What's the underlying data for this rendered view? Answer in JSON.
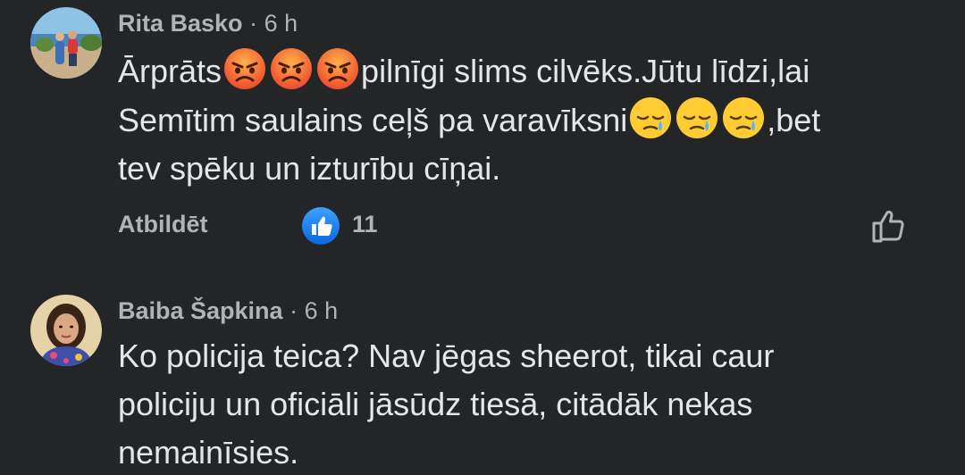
{
  "comments": [
    {
      "author": "Rita Basko",
      "separator": "·",
      "time": "6 h",
      "text": {
        "line1_pre": "Ārprāts",
        "line1_post": "pilnīgi slims cilvēks.Jūtu līdzi,lai",
        "line2_pre": "Semītim saulains ceļš pa varavīksni",
        "line2_post": ",bet",
        "line3": "tev spēku un izturību cīņai."
      },
      "emojis": [
        "angry-face-icon",
        "angry-face-icon",
        "angry-face-icon",
        "sad-tear-face-icon",
        "sad-tear-face-icon",
        "sad-tear-face-icon"
      ],
      "reply_label": "Atbildēt",
      "reaction_count": "11",
      "reaction_type": "like"
    },
    {
      "author": "Baiba Šapkina",
      "separator": "·",
      "time": "6 h",
      "text": {
        "line1": "Ko policija teica? Nav jēgas sheerot, tikai caur",
        "line2": "policiju un oficiāli jāsūdz tiesā, citādāk nekas",
        "line3": "nemainīsies."
      }
    }
  ],
  "colors": {
    "background": "#242526",
    "primary_text": "#e4e6eb",
    "secondary_text": "#b0b3b8",
    "like_blue": "#1877f2"
  }
}
